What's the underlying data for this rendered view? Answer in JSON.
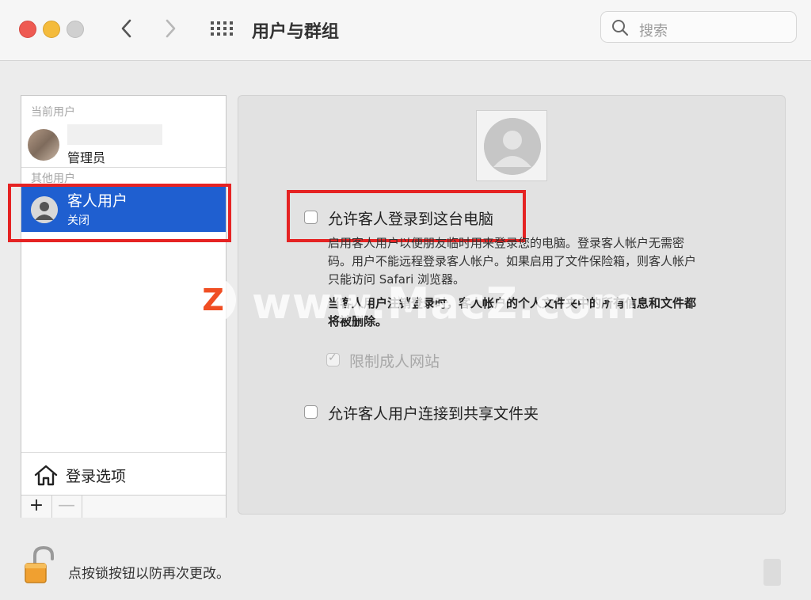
{
  "window": {
    "title": "用户与群组",
    "search_placeholder": "搜索"
  },
  "sidebar": {
    "current_users_header": "当前用户",
    "current_user_role": "管理员",
    "other_users_header": "其他用户",
    "guest_name": "客人用户",
    "guest_status": "关闭",
    "login_options": "登录选项",
    "add_label": "+",
    "remove_label": "—"
  },
  "main": {
    "allow_guest_login": "允许客人登录到这台电脑",
    "desc_1": "启用客人用户以便朋友临时用来登录您的电脑。登录客人帐户无需密",
    "desc_2": "码。用户不能远程登录客人帐户。如果启用了文件保险箱，则客人帐户",
    "desc_3": "只能访问 Safari 浏览器。",
    "warn_1": "当客人用户注销登录时，客人帐户的个人文件夹中的所有信息和文件都",
    "warn_2": "将被删除。",
    "restrict_adult": "限制成人网站",
    "allow_shared_folders": "允许客人用户连接到共享文件夹"
  },
  "footer": {
    "lock_text": "点按锁按钮以防再次更改。"
  },
  "watermark": {
    "logo_letter": "Z",
    "text": "www.MacZ.com"
  },
  "colors": {
    "selection_blue": "#1f5fd0",
    "highlight_red": "#e52323",
    "lock_orange": "#f0a030"
  }
}
